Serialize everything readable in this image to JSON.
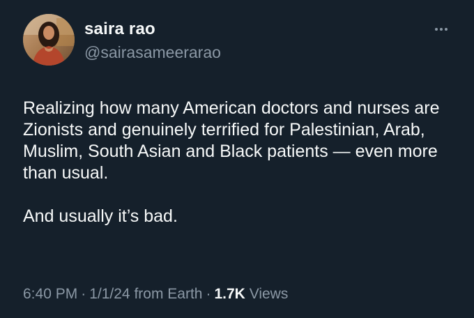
{
  "author": {
    "display_name": "saira rao",
    "handle": "@sairasameerarao"
  },
  "tweet": {
    "paragraphs": [
      "Realizing how many American doctors and nurses are Zionists and genuinely terrified for Palestinian, Arab, Muslim, South Asian and Black patients — even more than usual.",
      "And usually it’s bad."
    ]
  },
  "meta": {
    "time": "6:40 PM",
    "separator": "·",
    "date": "1/1/24",
    "location": "from Earth",
    "views_count": "1.7K",
    "views_label": "Views"
  },
  "icons": {
    "more": "more-horizontal-icon"
  },
  "colors": {
    "background": "#15202b",
    "text_primary": "#f7f9f9",
    "text_secondary": "#8b98a5"
  }
}
